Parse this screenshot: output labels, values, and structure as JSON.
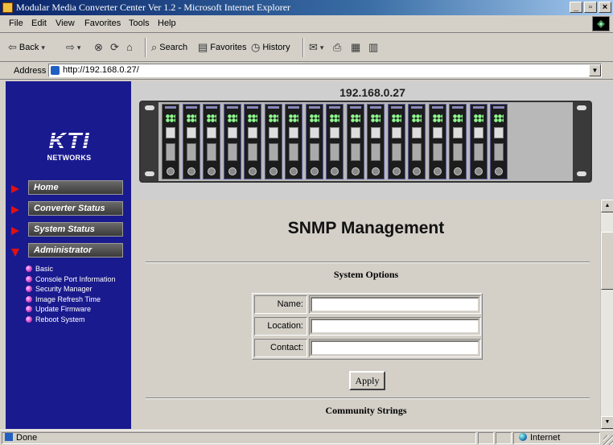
{
  "window": {
    "title": "Modular Media Converter Center Ver 1.2 - Microsoft Internet Explorer"
  },
  "menu": [
    {
      "label": "File",
      "accel": "F"
    },
    {
      "label": "Edit",
      "accel": "E"
    },
    {
      "label": "View",
      "accel": "V"
    },
    {
      "label": "Favorites",
      "accel": "a"
    },
    {
      "label": "Tools",
      "accel": "T"
    },
    {
      "label": "Help",
      "accel": "H"
    }
  ],
  "toolbar": {
    "back_label": "Back",
    "search_label": "Search",
    "favorites_label": "Favorites",
    "history_label": "History"
  },
  "address": {
    "label": "Address",
    "url": "http://192.168.0.27/"
  },
  "brand": {
    "logo_text": "KTI",
    "logo_sub": "NETWORKS"
  },
  "nav": {
    "home": "Home",
    "converter_status": "Converter Status",
    "system_status": "System Status",
    "administrator": "Administrator",
    "admin_items": [
      "Basic",
      "Console Port Information",
      "Security Manager",
      "Image Refresh Time",
      "Update Firmware",
      "Reboot System"
    ]
  },
  "device": {
    "ip": "192.168.0.27",
    "slot_count": 17
  },
  "page": {
    "title": "SNMP Management",
    "system_options_title": "System Options",
    "fields": [
      {
        "label": "Name:",
        "value": ""
      },
      {
        "label": "Location:",
        "value": ""
      },
      {
        "label": "Contact:",
        "value": ""
      }
    ],
    "apply_label": "Apply",
    "community_strings_title": "Community Strings"
  },
  "status": {
    "text": "Done",
    "zone": "Internet"
  }
}
